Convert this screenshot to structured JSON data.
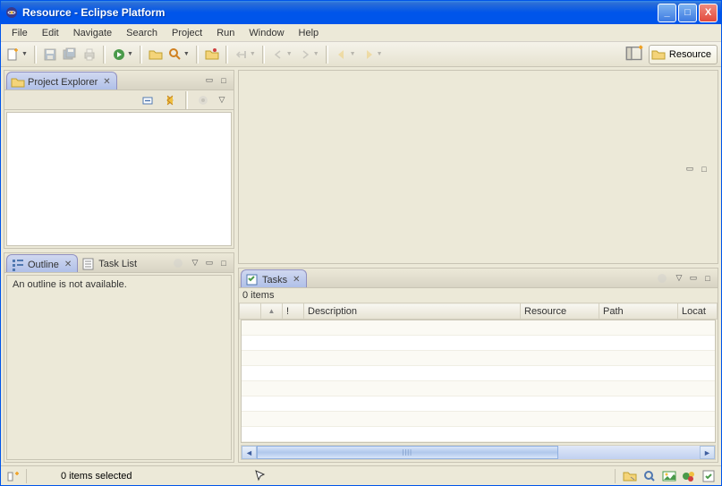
{
  "window": {
    "title": "Resource - Eclipse Platform"
  },
  "menu": [
    "File",
    "Edit",
    "Navigate",
    "Search",
    "Project",
    "Run",
    "Window",
    "Help"
  ],
  "perspective": {
    "label": "Resource"
  },
  "views": {
    "projectExplorer": {
      "tab": "Project Explorer"
    },
    "outline": {
      "tab": "Outline",
      "taskListTab": "Task List",
      "message": "An outline is not available."
    },
    "tasks": {
      "tab": "Tasks",
      "itemCount": "0 items",
      "columns": {
        "priority": "!",
        "description": "Description",
        "resource": "Resource",
        "path": "Path",
        "location": "Locat"
      }
    }
  },
  "status": {
    "selection": "0 items selected"
  }
}
